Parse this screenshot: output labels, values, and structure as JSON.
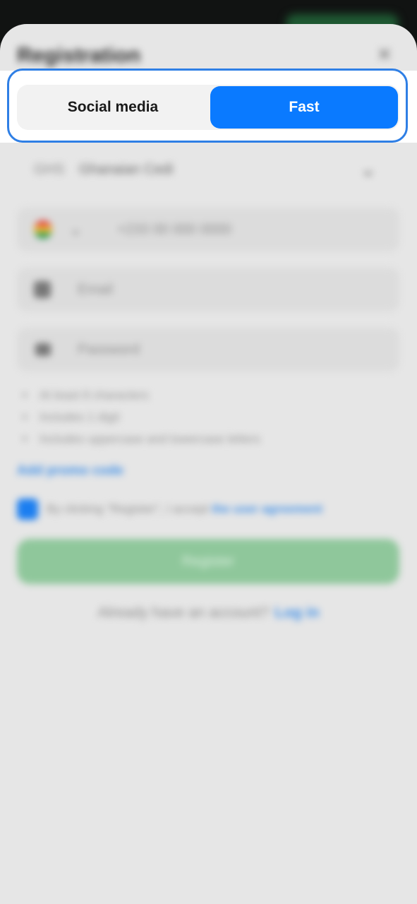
{
  "header": {
    "title": "Registration",
    "close_label": "✕"
  },
  "tabs": [
    {
      "label": "Social media",
      "selected": false
    },
    {
      "label": "Fast",
      "selected": true
    }
  ],
  "form": {
    "currency": {
      "code": "GHS",
      "name": "Ghanaian Cedi"
    },
    "phone": {
      "placeholder": "+233 00 000 0000"
    },
    "email": {
      "placeholder": "Email"
    },
    "password": {
      "placeholder": "Password"
    },
    "rules": [
      "At least 8 characters",
      "Includes 1 digit",
      "Includes uppercase and lowercase letters"
    ],
    "promo_label": "Add promo code",
    "agreement": {
      "text": "By clicking \"Register\", I accept ",
      "link": "the user agreement",
      "checked": true
    },
    "register_label": "Register",
    "login_prompt": "Already have an account?",
    "login_link": "Log in"
  },
  "colors": {
    "accent": "#0a7aff",
    "highlight_border": "#2f7fe5",
    "register_green": "#8fc79b",
    "link_blue": "#3b8de8"
  }
}
